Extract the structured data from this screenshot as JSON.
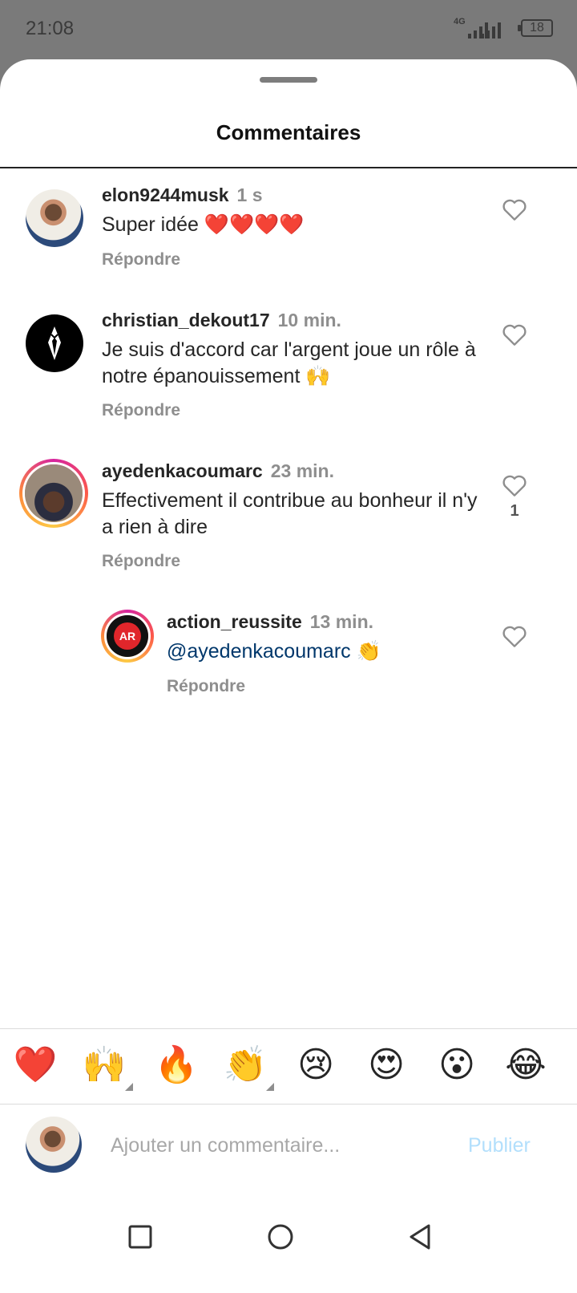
{
  "status_bar": {
    "time": "21:08",
    "network": "4G",
    "battery": "18"
  },
  "sheet": {
    "title": "Commentaires"
  },
  "comments": [
    {
      "username": "elon9244musk",
      "time": "1 s",
      "text": "Super idée ❤️❤️❤️❤️",
      "reply": "Répondre",
      "likes": ""
    },
    {
      "username": "christian_dekout17",
      "time": "10 min.",
      "text": "Je suis d'accord car l'argent joue un rôle à notre épanouissement 🙌",
      "reply": "Répondre",
      "likes": ""
    },
    {
      "username": "ayedenkacoumarc",
      "time": "23 min.",
      "text": "Effectivement il contribue au bonheur il n'y a rien à dire",
      "reply": "Répondre",
      "likes": "1"
    },
    {
      "username": "action_reussite",
      "time": "13 min.",
      "mention": "@ayedenkacoumarc",
      "text": " 👏",
      "reply": "Répondre",
      "likes": ""
    }
  ],
  "reactions": [
    "❤️",
    "🙌",
    "🔥",
    "👏",
    "😢",
    "😍",
    "😮",
    "😂"
  ],
  "composer": {
    "placeholder": "Ajouter un commentaire...",
    "publish_label": "Publier"
  },
  "colors": {
    "accent_link": "#00376b",
    "publish_disabled": "#b2dffc",
    "muted": "#8e8e8e"
  },
  "icons": {
    "like": "heart-outline-icon",
    "nav": [
      "square-recents-icon",
      "circle-home-icon",
      "triangle-back-icon"
    ]
  }
}
